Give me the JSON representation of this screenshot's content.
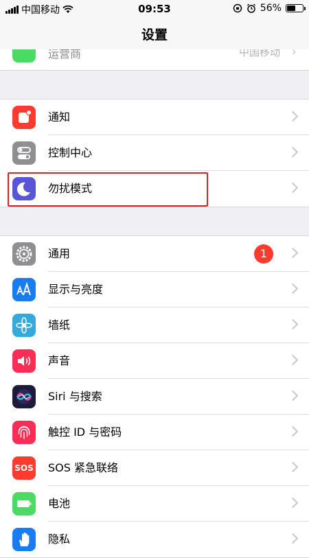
{
  "status_bar": {
    "carrier": "中国移动",
    "time": "09:53",
    "battery": "56%",
    "battery_level": 0.56
  },
  "nav": {
    "title": "设置"
  },
  "partial_row": {
    "label": "运营商",
    "detail": "中国移动"
  },
  "group1": {
    "items": [
      {
        "label": "通知",
        "icon": "notifications-icon",
        "color": "#ff3b30"
      },
      {
        "label": "控制中心",
        "icon": "control-center-icon",
        "color": "#8e8e93"
      },
      {
        "label": "勿扰模式",
        "icon": "moon-icon",
        "color": "#5856d6"
      }
    ]
  },
  "group2": {
    "items": [
      {
        "label": "通用",
        "icon": "gear-icon",
        "color": "#8e8e93",
        "badge": "1"
      },
      {
        "label": "显示与亮度",
        "icon": "display-aa-icon",
        "color": "#1a7cf2"
      },
      {
        "label": "墙纸",
        "icon": "wallpaper-flower-icon",
        "color": "#34aadc"
      },
      {
        "label": "声音",
        "icon": "speaker-icon",
        "color": "#ff2d55"
      },
      {
        "label": "Siri 与搜索",
        "icon": "siri-icon",
        "color": "#1c1c3a"
      },
      {
        "label": "触控 ID 与密码",
        "icon": "fingerprint-icon",
        "color": "#ff2d55"
      },
      {
        "label": "SOS 紧急联络",
        "icon": "sos-icon",
        "color": "#ff3b30",
        "icon_text": "SOS"
      },
      {
        "label": "电池",
        "icon": "battery-icon",
        "color": "#4cd964"
      },
      {
        "label": "隐私",
        "icon": "hand-icon",
        "color": "#1a7cf2"
      }
    ]
  }
}
